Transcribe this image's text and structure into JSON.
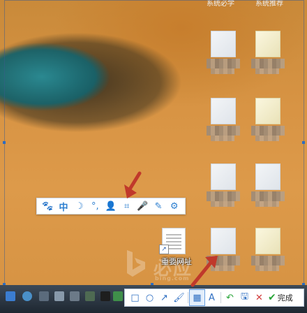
{
  "top_bar": {
    "left_text": "系统必学",
    "right_text": "系统推荐"
  },
  "desktop": {
    "shortcut_icon": {
      "label": "重要网址"
    },
    "blurred_icon_count": 8
  },
  "floating_toolbar": {
    "items": [
      {
        "name": "paw-icon",
        "glyph": "🐾"
      },
      {
        "name": "chinese-input-mode",
        "glyph": "中"
      },
      {
        "name": "moon-icon",
        "glyph": "☽"
      },
      {
        "name": "punctuation-icon",
        "glyph": "°,"
      },
      {
        "name": "user-icon",
        "glyph": "👤"
      },
      {
        "name": "crop-icon",
        "glyph": "⌗"
      },
      {
        "name": "microphone-icon",
        "glyph": "🎤"
      },
      {
        "name": "pen-icon",
        "glyph": "✎"
      },
      {
        "name": "settings-gear-icon",
        "glyph": "⚙"
      }
    ]
  },
  "screenshot_toolbar": {
    "tools": [
      {
        "name": "rectangle-tool",
        "glyph": "□"
      },
      {
        "name": "ellipse-tool",
        "glyph": "○"
      },
      {
        "name": "arrow-tool",
        "glyph": "↗"
      },
      {
        "name": "brush-tool",
        "glyph": "🖌"
      },
      {
        "name": "mosaic-tool",
        "glyph": "▦",
        "active": true
      },
      {
        "name": "text-tool",
        "glyph": "A"
      },
      {
        "name": "undo-tool",
        "glyph": "↶"
      },
      {
        "name": "save-tool",
        "glyph": "🖫"
      },
      {
        "name": "cancel-tool",
        "glyph": "✕"
      }
    ],
    "done_label": "完成"
  },
  "watermark": {
    "text": "必应",
    "sub": "bing.com"
  },
  "colors": {
    "accent": "#2d7fd0",
    "arrow": "#c0392b",
    "taskbar": "#25303b"
  }
}
